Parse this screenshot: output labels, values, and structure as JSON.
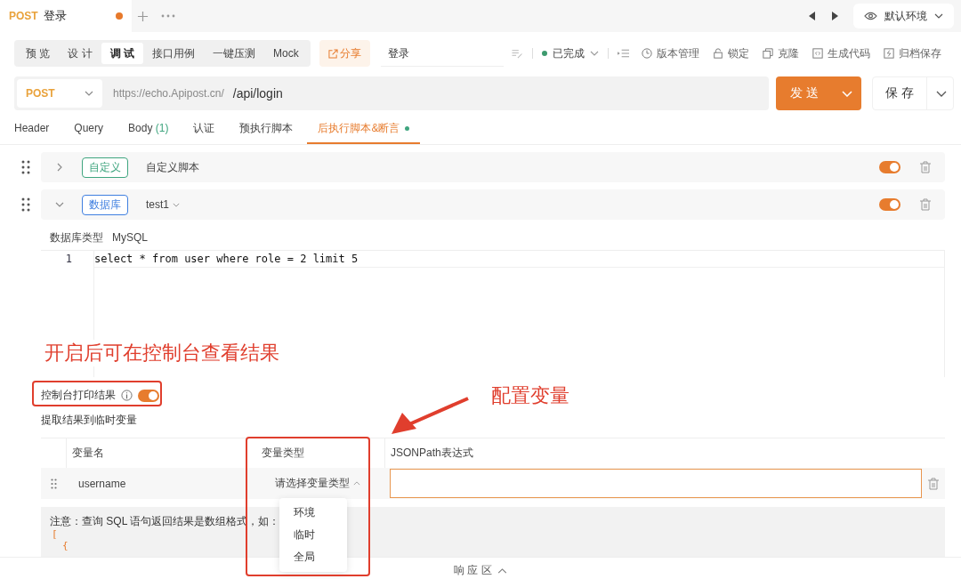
{
  "file_tabs": [
    {
      "method": "POST",
      "title": "登录",
      "modified": true,
      "selected": true
    }
  ],
  "environment": "默认环境",
  "mode_tabs": [
    {
      "label": "预 览",
      "selected": false
    },
    {
      "label": "设 计",
      "selected": false
    },
    {
      "label": "调 试",
      "selected": true
    },
    {
      "label": "接口用例",
      "selected": false
    },
    {
      "label": "一键压测",
      "selected": false
    },
    {
      "label": "Mock",
      "selected": false
    }
  ],
  "share": "分享",
  "name_field": {
    "value": "登录"
  },
  "status": {
    "label": "已完成",
    "color": "#3d9a6e"
  },
  "actions": [
    {
      "kind": "history",
      "label": "版本管理"
    },
    {
      "kind": "lock",
      "label": "锁定"
    },
    {
      "kind": "clone",
      "label": "克隆"
    },
    {
      "kind": "code",
      "label": "生成代码"
    },
    {
      "kind": "archive",
      "label": "归档保存"
    }
  ],
  "url": {
    "method": "POST",
    "base": "https://echo.Apipost.cn/",
    "path": "/api/login"
  },
  "send": "发 送",
  "save": "保 存",
  "request_tabs": [
    {
      "label": "Header",
      "selected": false
    },
    {
      "label": "Query",
      "selected": false
    },
    {
      "label": "Body",
      "count": "(1)",
      "selected": false
    },
    {
      "label": "认证",
      "selected": false
    },
    {
      "label": "预执行脚本",
      "selected": false
    },
    {
      "label": "后执行脚本&断言",
      "selected": true,
      "dot": true
    }
  ],
  "scripts": [
    {
      "kind": "custom",
      "tag": "自定义",
      "color": "#3fa57f",
      "name": "自定义脚本",
      "expanded": false,
      "enabled": true
    },
    {
      "kind": "database",
      "tag": "数据库",
      "color": "#3f7fe0",
      "name": "test1",
      "expanded": true,
      "enabled": true
    }
  ],
  "database": {
    "type_label": "数据库类型",
    "type": "MySQL"
  },
  "editor": {
    "lines": [
      {
        "number": "1",
        "code": "select * from user where role = 2 limit 5"
      }
    ]
  },
  "console_print": {
    "label": "控制台打印结果",
    "on": true
  },
  "extract": {
    "title": "提取结果到临时变量",
    "columns": [
      "变量名",
      "变量类型",
      "JSONPath表达式"
    ],
    "rows": [
      {
        "name": "username",
        "type_placeholder": "请选择变量类型",
        "focused": true
      }
    ]
  },
  "type_dropdown": {
    "options": [
      "环境",
      "临时",
      "全局"
    ]
  },
  "note": {
    "text": "注意：查询 SQL 语句返回结果是数组格式，如：",
    "lines": [
      "[",
      "{"
    ]
  },
  "response_bar": "响 应 区",
  "annotations": {
    "console_hint": "开启后可在控制台查看结果",
    "variable_hint": "配置变量"
  }
}
